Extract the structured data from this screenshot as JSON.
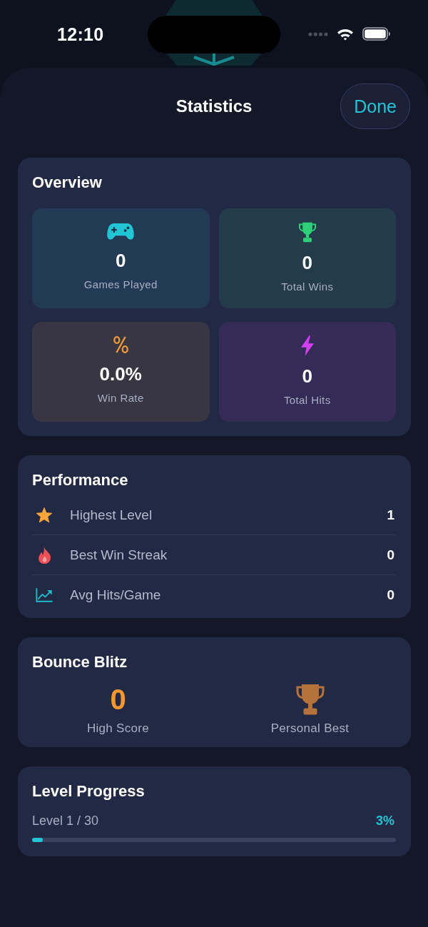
{
  "status_bar": {
    "time": "12:10"
  },
  "header": {
    "title": "Statistics",
    "done_button": "Done"
  },
  "overview": {
    "title": "Overview",
    "tiles": [
      {
        "kind": "controller",
        "color": "#22c5d4",
        "value": "0",
        "label": "Games Played"
      },
      {
        "kind": "trophy",
        "color": "#2fcf7a",
        "value": "0",
        "label": "Total Wins"
      },
      {
        "kind": "percent",
        "color": "#f59b38",
        "value": "0.0%",
        "label": "Win Rate"
      },
      {
        "kind": "bolt",
        "color": "#d23ff2",
        "value": "0",
        "label": "Total Hits"
      }
    ]
  },
  "performance": {
    "title": "Performance",
    "rows": [
      {
        "kind": "star",
        "color": "#f8a53c",
        "label": "Highest Level",
        "value": "1"
      },
      {
        "kind": "flame",
        "color": "#ec4f55",
        "label": "Best Win Streak",
        "value": "0"
      },
      {
        "kind": "chart",
        "color": "#1fbccb",
        "label": "Avg Hits/Game",
        "value": "0"
      }
    ]
  },
  "game": {
    "title": "Bounce Blitz",
    "high_score": {
      "value": "0",
      "label": "High Score"
    },
    "personal_best": {
      "label": "Personal Best"
    }
  },
  "level_progress": {
    "title": "Level Progress",
    "label": "Level 1 / 30",
    "percent": "3%",
    "level": 0.03
  }
}
